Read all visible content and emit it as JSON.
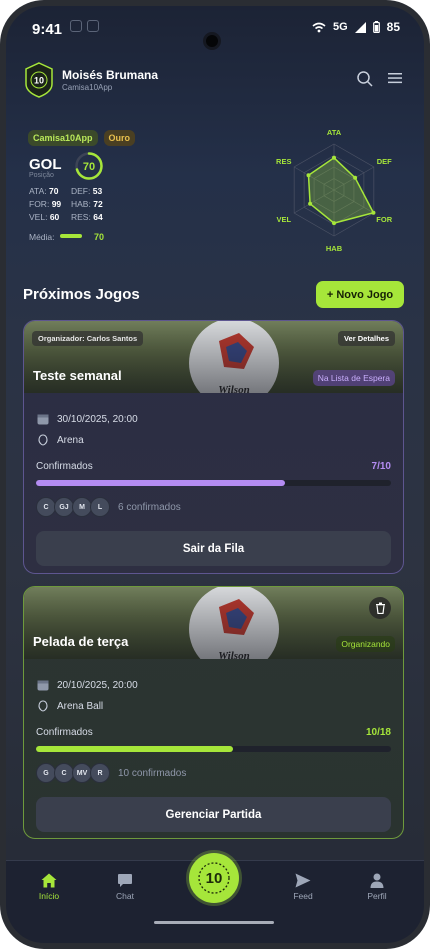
{
  "status_bar": {
    "time": "9:41",
    "network": "5G",
    "battery": "85"
  },
  "header": {
    "user_name": "Moisés Brumana",
    "app_name": "Camisa10App",
    "logo_text": "10"
  },
  "profile": {
    "badge_app": "Camisa10App",
    "badge_tier": "Ouro",
    "position": "GOL",
    "position_label": "Posição",
    "overall": "70",
    "stats": [
      {
        "label": "ATA:",
        "value": "70"
      },
      {
        "label": "DEF:",
        "value": "53"
      },
      {
        "label": "FOR:",
        "value": "99"
      },
      {
        "label": "HAB:",
        "value": "72"
      },
      {
        "label": "VEL:",
        "value": "60"
      },
      {
        "label": "RES:",
        "value": "64"
      }
    ],
    "media_label": "Média:",
    "media_value": "70",
    "radar_axes": [
      "ATA",
      "DEF",
      "FOR",
      "HAB",
      "VEL",
      "RES"
    ],
    "radar_values": [
      70,
      53,
      99,
      72,
      60,
      64
    ],
    "accent_color": "#a6e63a"
  },
  "section": {
    "title": "Próximos Jogos",
    "new_button": "+ Novo Jogo"
  },
  "matches": [
    {
      "organizer": "Organizador: Carlos Santos",
      "details": "Ver Detalhes",
      "title": "Teste semanal",
      "status": "Na Lista de Espera",
      "datetime": "30/10/2025, 20:00",
      "location": "Arena",
      "confirmed_label": "Confirmados",
      "confirmed_count": "7/10",
      "fill": 0.7,
      "bar_color": "#b48cf2",
      "avatars": [
        "C",
        "GJ",
        "M",
        "L"
      ],
      "confirmed_text": "6 confirmados",
      "action": "Sair da Fila"
    },
    {
      "title": "Pelada de terça",
      "status": "Organizando",
      "datetime": "20/10/2025, 20:00",
      "location": "Arena Ball",
      "confirmed_label": "Confirmados",
      "confirmed_count": "10/18",
      "fill": 0.556,
      "bar_color": "#a6e63a",
      "avatars": [
        "G",
        "C",
        "MV",
        "R"
      ],
      "confirmed_text": "10 confirmados",
      "action": "Gerenciar Partida"
    }
  ],
  "nav": {
    "items": [
      {
        "label": "Início",
        "icon": "home-icon"
      },
      {
        "label": "Chat",
        "icon": "chat-icon"
      },
      {
        "label": "Feed",
        "icon": "send-icon"
      },
      {
        "label": "Perfil",
        "icon": "person-icon"
      }
    ],
    "center_label": "10"
  }
}
